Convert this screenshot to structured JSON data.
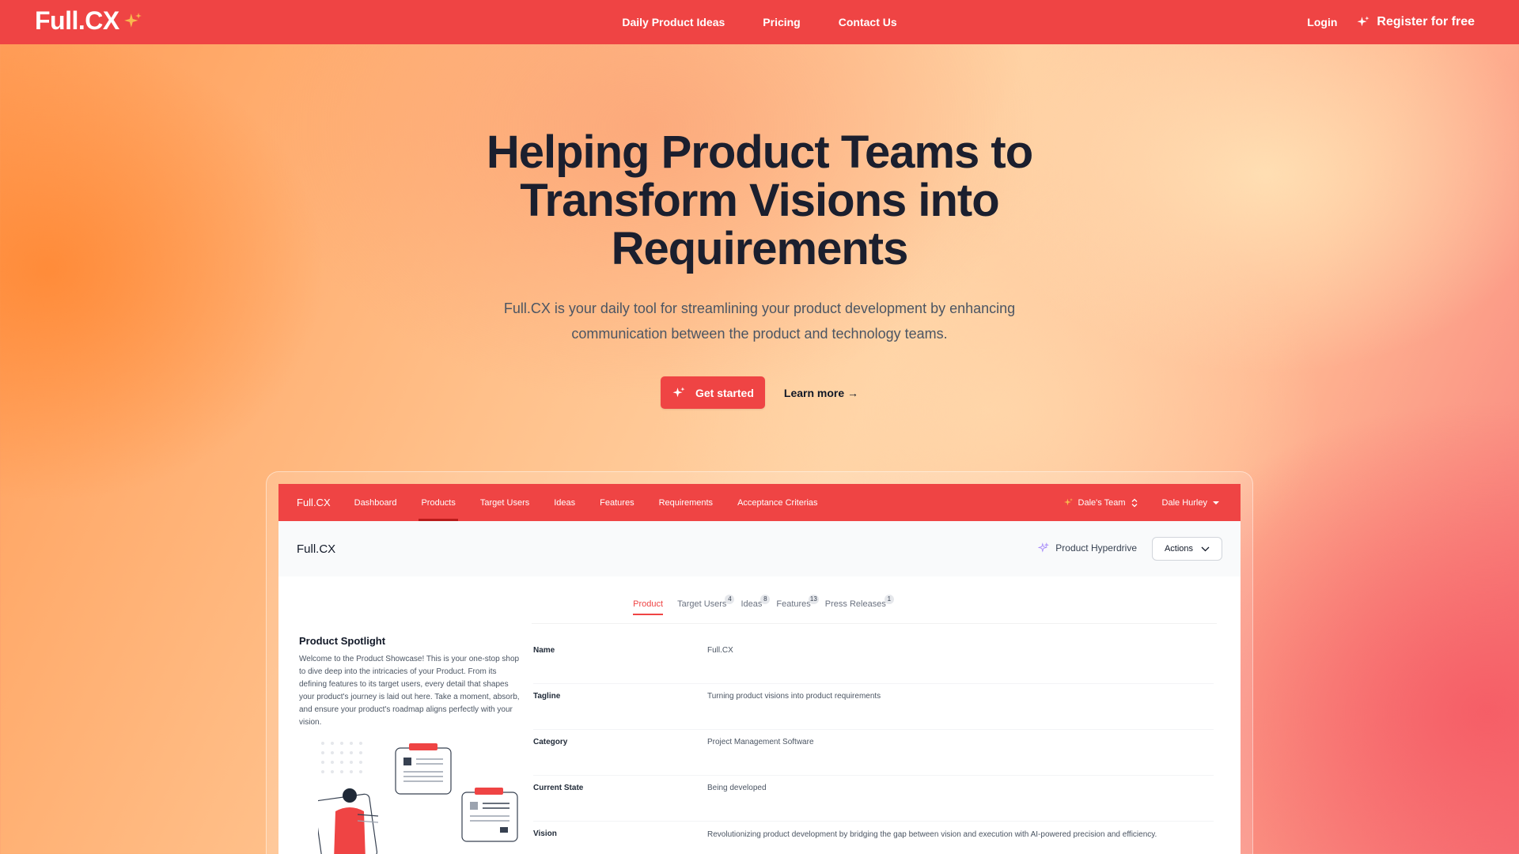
{
  "nav": {
    "logo": "Full.CX",
    "links": [
      "Daily Product Ideas",
      "Pricing",
      "Contact Us"
    ],
    "login": "Login",
    "register": "Register for free"
  },
  "hero": {
    "title": "Helping Product Teams to Transform Visions into Requirements",
    "subtitle": "Full.CX is your daily tool for streamlining your product development by enhancing communication between the product and technology teams.",
    "cta_primary": "Get started",
    "cta_secondary": "Learn more →"
  },
  "app": {
    "brand": "Full.CX",
    "nav_items": [
      "Dashboard",
      "Products",
      "Target Users",
      "Ideas",
      "Features",
      "Requirements",
      "Acceptance Criterias"
    ],
    "active_nav": "Products",
    "team": "Dale's Team",
    "user": "Dale Hurley",
    "page_title": "Full.CX",
    "hyperdrive": "Product Hyperdrive",
    "actions": "Actions",
    "tabs": [
      {
        "label": "Product",
        "badge": ""
      },
      {
        "label": "Target Users",
        "badge": "4"
      },
      {
        "label": "Ideas",
        "badge": "8"
      },
      {
        "label": "Features",
        "badge": "13"
      },
      {
        "label": "Press Releases",
        "badge": "1"
      }
    ],
    "spotlight_title": "Product Spotlight",
    "spotlight_desc": "Welcome to the Product Showcase! This is your one-stop shop to dive deep into the intricacies of your Product. From its defining features to its target users, every detail that shapes your product's journey is laid out here. Take a moment, absorb, and ensure your product's roadmap aligns perfectly with your vision.",
    "fields": [
      {
        "label": "Name",
        "value": "Full.CX"
      },
      {
        "label": "Tagline",
        "value": "Turning product visions into product requirements"
      },
      {
        "label": "Category",
        "value": "Project Management Software"
      },
      {
        "label": "Current State",
        "value": "Being developed"
      },
      {
        "label": "Vision",
        "value": "Revolutionizing product development by bridging the gap between vision and execution with AI-powered precision and efficiency."
      }
    ]
  },
  "colors": {
    "brand_red": "#ef4444",
    "sparkle": "#f59e0b"
  }
}
